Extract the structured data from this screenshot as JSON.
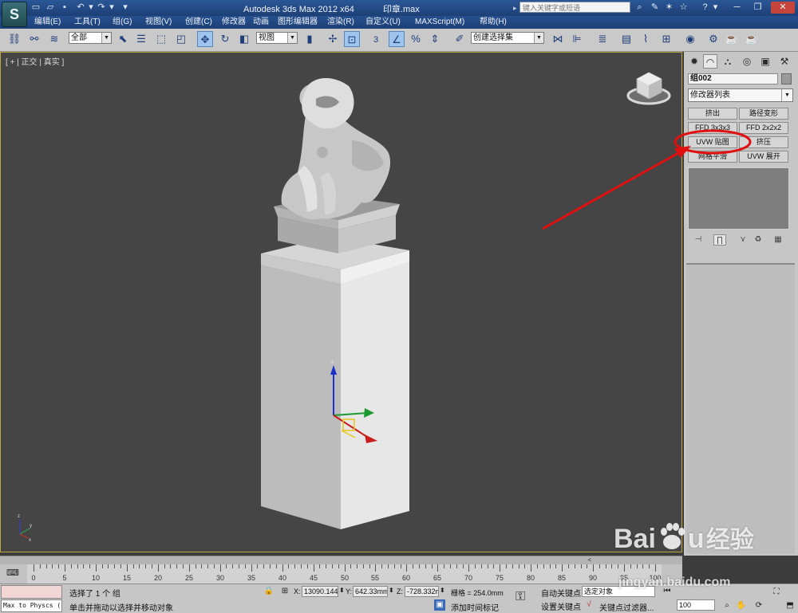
{
  "title_bar": {
    "app_title": "Autodesk 3ds Max  2012 x64",
    "file_name": "印章.max",
    "search_placeholder": "键入关键字或短语",
    "app_icon_glyph": "S",
    "icons": [
      "new-file-icon",
      "open-file-icon",
      "save-icon",
      "undo-icon",
      "redo-icon",
      "search-binoculars-icon",
      "communication-icon",
      "star-icon",
      "favorites-icon",
      "help-icon",
      "minimize-icon",
      "restore-icon",
      "close-icon"
    ]
  },
  "menu": [
    "编辑(E)",
    "工具(T)",
    "组(G)",
    "视图(V)",
    "创建(C)",
    "修改器",
    "动画",
    "图形编辑器",
    "渲染(R)",
    "自定义(U)",
    "MAXScript(M)",
    "帮助(H)"
  ],
  "toolbar": {
    "selection_filter": "全部",
    "reference_coord": "视图",
    "named_selection": "创建选择集",
    "snap_value": "3"
  },
  "viewport": {
    "label": "[ + ] 正交 ] 真实 ]",
    "label_plus": "+",
    "label_view": "正交",
    "label_shading": "真实",
    "gizmo_axes": [
      "z",
      "y",
      "x"
    ],
    "world_axes": [
      "z",
      "y",
      "x"
    ]
  },
  "command_panel": {
    "object_name": "组002",
    "modifier_list": "修改器列表",
    "modifier_buttons": [
      "挤出",
      "路径变形",
      "FFD 3x3x3",
      "FFD 2x2x2",
      "UVW 贴图",
      "挤压",
      "网格平滑",
      "UVW 展开"
    ],
    "highlighted_button": "UVW 贴图"
  },
  "timeline": {
    "ticks": [
      "0",
      "5",
      "10",
      "15",
      "20",
      "25",
      "30",
      "35",
      "40",
      "45",
      "50",
      "55",
      "60",
      "65",
      "70",
      "75",
      "80",
      "85",
      "90",
      "95",
      "100"
    ],
    "slider_label": "<"
  },
  "status": {
    "maxscript_listener": "Max to Physcs (",
    "selection_info": "选择了 1 个 组",
    "prompt": "单击并拖动以选择并移动对象",
    "x_label": "X:",
    "x_value": "13090.144",
    "y_label": "Y:",
    "y_value": "642.33mm",
    "z_label": "Z:",
    "z_value": "-728.332m",
    "grid": "栅格 = 254.0mm",
    "add_time_tag": "添加时间标记",
    "auto_key": "自动关键点",
    "set_key": "设置关键点",
    "selected_object": "选定对象",
    "key_filters": "关键点过滤器...",
    "frame_value": "100"
  },
  "watermark": {
    "brand_latin_1": "Bai",
    "brand_latin_2": "u",
    "brand_cn": "经验",
    "domain": "jingyan.baidu.com"
  },
  "colors": {
    "annotation_red": "#e01010",
    "viewport_bg": "#454545",
    "panel_bg": "#c6c6c6",
    "titlebar_blue": "#1d3f75"
  }
}
